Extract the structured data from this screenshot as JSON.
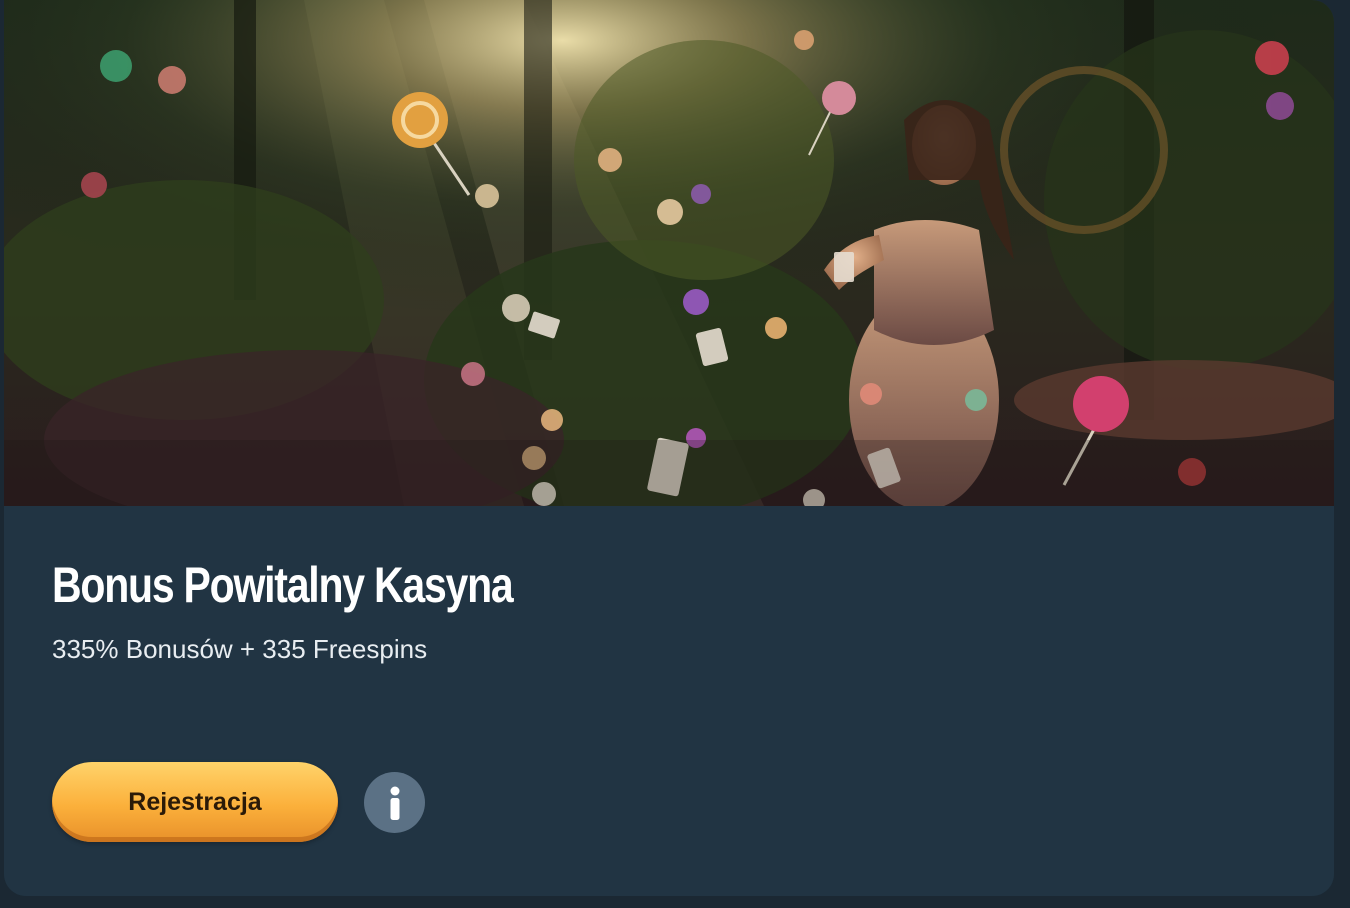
{
  "promo": {
    "title": "Bonus Powitalny Kasyna",
    "subtitle": "335% Bonusów + 335 Freespins",
    "register_label": "Rejestracja",
    "info_icon": "info-icon",
    "hero_image": "casino-jungle-woman-with-cards-and-chips",
    "colors": {
      "card_bg": "#213443",
      "button": "#fbb03b",
      "info_bg": "#5b7185"
    }
  }
}
